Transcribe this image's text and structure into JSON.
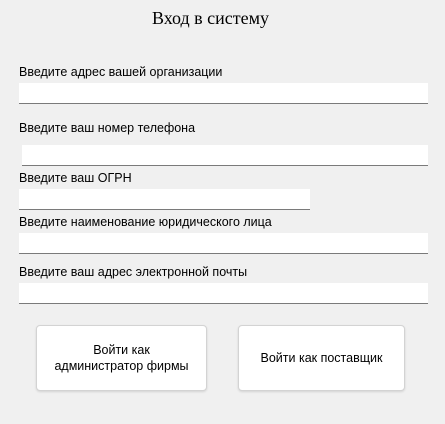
{
  "window": {
    "title": "Вход в систему"
  },
  "form": {
    "address_label": "Введите адрес вашей организации",
    "address_value": "",
    "phone_label": "Введите ваш номер телефона",
    "phone_value": "",
    "ogrn_label": "Введите ваш ОГРН",
    "ogrn_value": "",
    "legal_name_label": "Введите наименование юридического лица",
    "legal_name_value": "",
    "email_label": "Введите ваш адрес электронной почты",
    "email_value": ""
  },
  "actions": {
    "admin_login_label": "Войти как\nадминистратор фирмы",
    "supplier_login_label": "Войти как поставщик"
  }
}
